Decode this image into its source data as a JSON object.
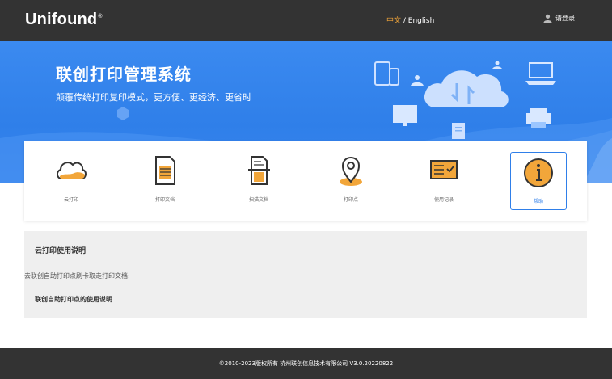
{
  "header": {
    "logo": "Unifound",
    "lang_cn": "中文",
    "lang_sep": " / ",
    "lang_en": "English",
    "login": "请登录"
  },
  "banner": {
    "title": "联创打印管理系统",
    "subtitle": "颠覆传统打印复印模式，更方便、更经济、更省时"
  },
  "functions": [
    {
      "label": "云打印",
      "icon": "cloud-icon"
    },
    {
      "label": "打印文档",
      "icon": "document-icon"
    },
    {
      "label": "扫描文档",
      "icon": "scan-document-icon"
    },
    {
      "label": "打印点",
      "icon": "location-pin-icon"
    },
    {
      "label": "使用记录",
      "icon": "usage-record-icon"
    },
    {
      "label": "帮助",
      "icon": "info-icon",
      "active": true
    }
  ],
  "help": {
    "title": "云打印使用说明",
    "desc": "去联创自助打印点刷卡取走打印文档:",
    "link": "联创自助打印点的使用说明"
  },
  "footer": {
    "text": "©2010-2023版权所有 杭州联创信息技术有限公司 V3.0.20220822"
  },
  "colors": {
    "accent": "#f2a63a",
    "brand_blue": "#2f7fe9",
    "dark_bar": "#333333"
  }
}
